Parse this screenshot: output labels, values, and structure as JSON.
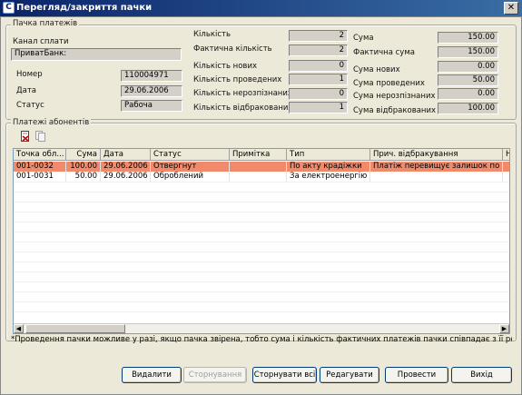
{
  "window": {
    "title": "Перегляд/закриття пачки",
    "app_icon": "C",
    "close_glyph": "✕"
  },
  "batch_group": {
    "title": "Пачка платежів",
    "channel_label": "Канал сплати",
    "channel_value": "ПриватБанк:",
    "number_label": "Номер",
    "number_value": "110004971",
    "date_label": "Дата",
    "date_value": "29.06.2006",
    "status_label": "Статус",
    "status_value": "Рабоча"
  },
  "counts": {
    "count_label": "Кількість",
    "count_value": "2",
    "actual_count_label": "Фактична кількість",
    "actual_count_value": "2",
    "new_count_label": "Кількість нових",
    "new_count_value": "0",
    "posted_count_label": "Кількість проведених",
    "posted_count_value": "1",
    "unrecognized_count_label": "Кількість нерозпізнаних",
    "unrecognized_count_value": "0",
    "rejected_count_label": "Кількість відбракованих",
    "rejected_count_value": "1"
  },
  "sums": {
    "sum_label": "Сума",
    "sum_value": "150.00",
    "actual_sum_label": "Фактична сума",
    "actual_sum_value": "150.00",
    "new_sum_label": "Сума нових",
    "new_sum_value": "0.00",
    "posted_sum_label": "Сума проведених",
    "posted_sum_value": "50.00",
    "unrecognized_sum_label": "Сума нерозпізнаних",
    "unrecognized_sum_value": "0.00",
    "rejected_sum_label": "Сума відбракованих",
    "rejected_sum_value": "100.00"
  },
  "payments_group": {
    "title": "Платежі абонентів",
    "toolbar_icons": [
      "delete-doc-icon",
      "copy-doc-icon"
    ]
  },
  "table": {
    "columns": [
      "Точка обл...",
      "Сума",
      "Дата",
      "Статус",
      "Примітка",
      "Тип",
      "Прич. відбракування",
      "Н"
    ],
    "rows": [
      [
        "001-0032",
        "100.00",
        "29.06.2006",
        "Отвергнут",
        "",
        "По акту крадіжки",
        "Платіж перевищує залишок по в...",
        ""
      ],
      [
        "001-0031",
        "50.00",
        "29.06.2006",
        "Оброблений",
        "",
        "За електроенергію",
        "",
        ""
      ]
    ],
    "selected_row_color": "#f08a6a"
  },
  "note": "*Проведення пачки можливе у разі, якщо пачка звірена, тобто сума і кількість фактичних платежів пачки співпадає з її реквізитами",
  "buttons": {
    "delete": "Видалити",
    "reverse": "Сторнування",
    "reverse_all": "Сторнувати всі",
    "edit": "Редагувати",
    "post": "Провести",
    "exit": "Вихід"
  }
}
